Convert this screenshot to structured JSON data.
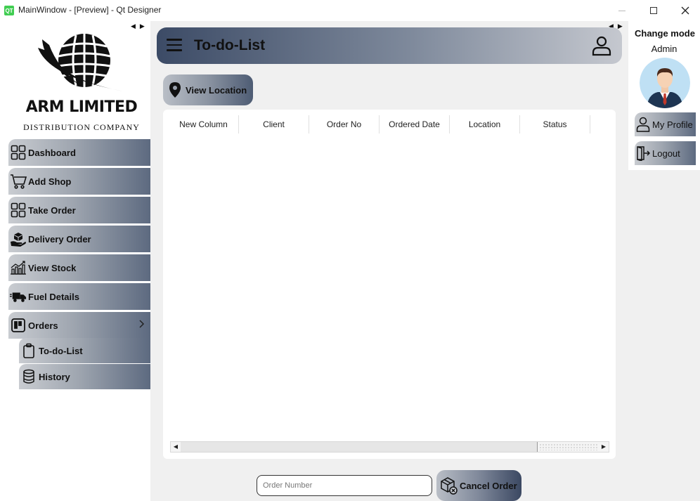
{
  "window": {
    "title": "MainWindow - [Preview] - Qt Designer",
    "app_icon_text": "QT"
  },
  "sidebar": {
    "brand_title": "ARM LIMITED",
    "brand_subtitle": "DISTRIBUTION COMPANY",
    "items": [
      {
        "label": "Dashboard",
        "icon": "dashboard-grid-icon"
      },
      {
        "label": "Add Shop",
        "icon": "cart-icon"
      },
      {
        "label": "Take Order",
        "icon": "grid-icon"
      },
      {
        "label": "Delivery Order",
        "icon": "hand-box-icon"
      },
      {
        "label": "View Stock",
        "icon": "stock-chart-icon"
      },
      {
        "label": "Fuel Details",
        "icon": "truck-icon"
      },
      {
        "label": "Orders",
        "icon": "trello-icon",
        "expanded": true
      },
      {
        "label": "To-do-List",
        "icon": "clipboard-icon"
      },
      {
        "label": "History",
        "icon": "database-icon"
      }
    ]
  },
  "header": {
    "title": "To-do-List"
  },
  "actions": {
    "view_location_label": "View Location",
    "cancel_order_label": "Cancel Order",
    "order_number_placeholder": "Order Number"
  },
  "table": {
    "columns": [
      "New Column",
      "Client",
      "Order No",
      "Ordered Date",
      "Location",
      "Status"
    ],
    "rows": []
  },
  "right_panel": {
    "change_mode_label": "Change mode",
    "role_label": "Admin",
    "my_profile_label": "My Profile",
    "logout_label": "Logout"
  },
  "colors": {
    "header_gradient_start": "#3c4b66",
    "header_gradient_end": "#c5c8cf",
    "nav_gradient_start": "#c9ccd1",
    "nav_gradient_end": "#5d6a80"
  }
}
